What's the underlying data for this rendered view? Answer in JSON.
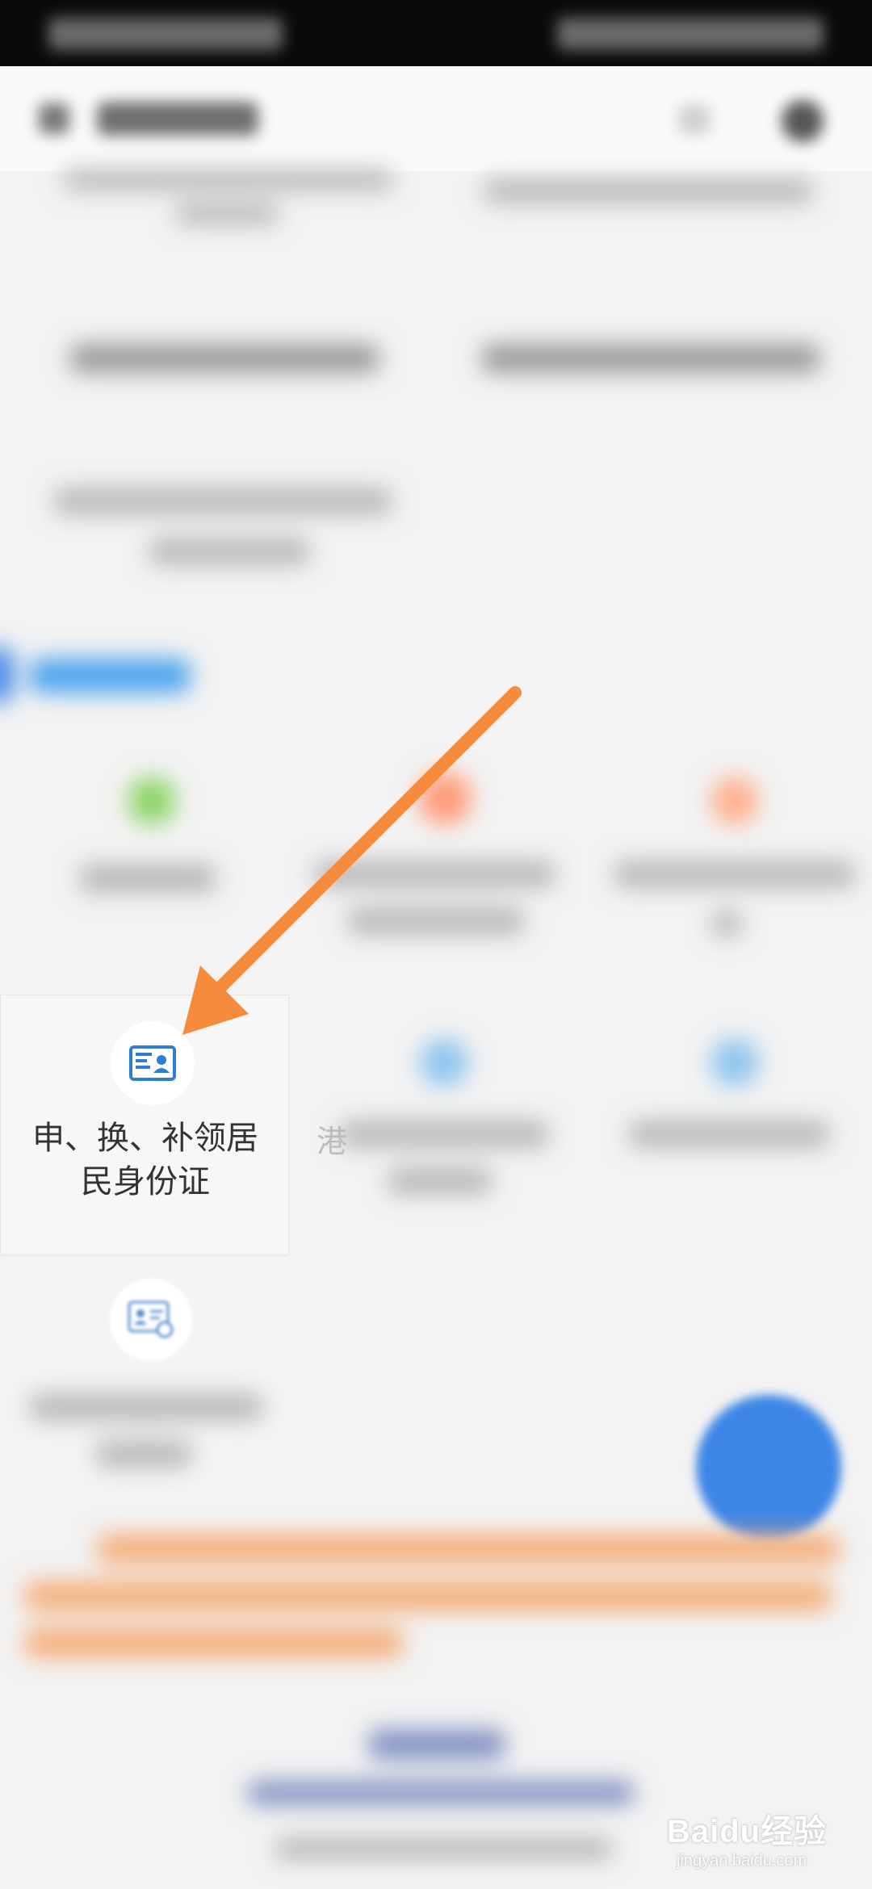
{
  "service_card": {
    "label": "申、换、补领居\n民身份证",
    "icon": "id-card-icon"
  },
  "partial_text": {
    "char": "港"
  },
  "second_card": {
    "icon": "id-card-stamp-icon"
  },
  "watermark": {
    "brand": "Baidu经验",
    "url": "jingyan.baidu.com"
  },
  "colors": {
    "arrow": "#f68b3c",
    "icon_blue": "#2e7fd1",
    "fab_blue": "#3d86e6"
  }
}
